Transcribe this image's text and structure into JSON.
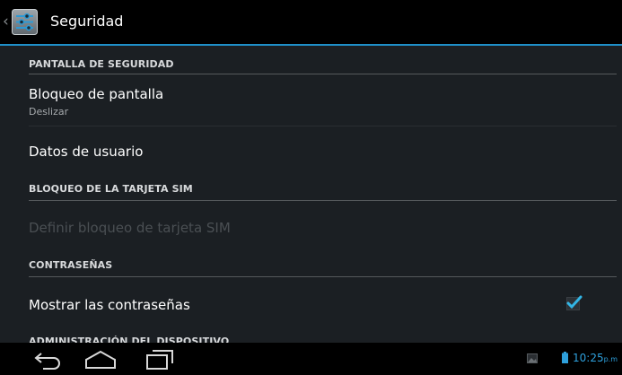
{
  "action_bar": {
    "title": "Seguridad",
    "back_icon": "chevron-left",
    "app_icon": "settings-sliders-icon",
    "accent_color": "#1f8fc9"
  },
  "sections": [
    {
      "header": "PANTALLA DE SEGURIDAD",
      "items": [
        {
          "title": "Bloqueo de pantalla",
          "summary": "Deslizar",
          "enabled": true
        },
        {
          "title": "Datos de usuario",
          "enabled": true
        }
      ]
    },
    {
      "header": "BLOQUEO DE LA TARJETA SIM",
      "items": [
        {
          "title": "Definir bloqueo de tarjeta SIM",
          "enabled": false
        }
      ]
    },
    {
      "header": "CONTRASEÑAS",
      "items": [
        {
          "title": "Mostrar las contraseñas",
          "enabled": true,
          "checked": true
        }
      ]
    },
    {
      "header": "ADMINISTRACIÓN DEL DISPOSITIVO",
      "items": []
    }
  ],
  "navigation": {
    "back": "back-icon",
    "home": "home-icon",
    "recents": "recent-apps-icon"
  },
  "status": {
    "time": "10:25",
    "ampm": "p.m",
    "battery_icon": "battery-icon",
    "notification_icon": "gallery-image-icon",
    "clock_color": "#2ea0dc"
  }
}
